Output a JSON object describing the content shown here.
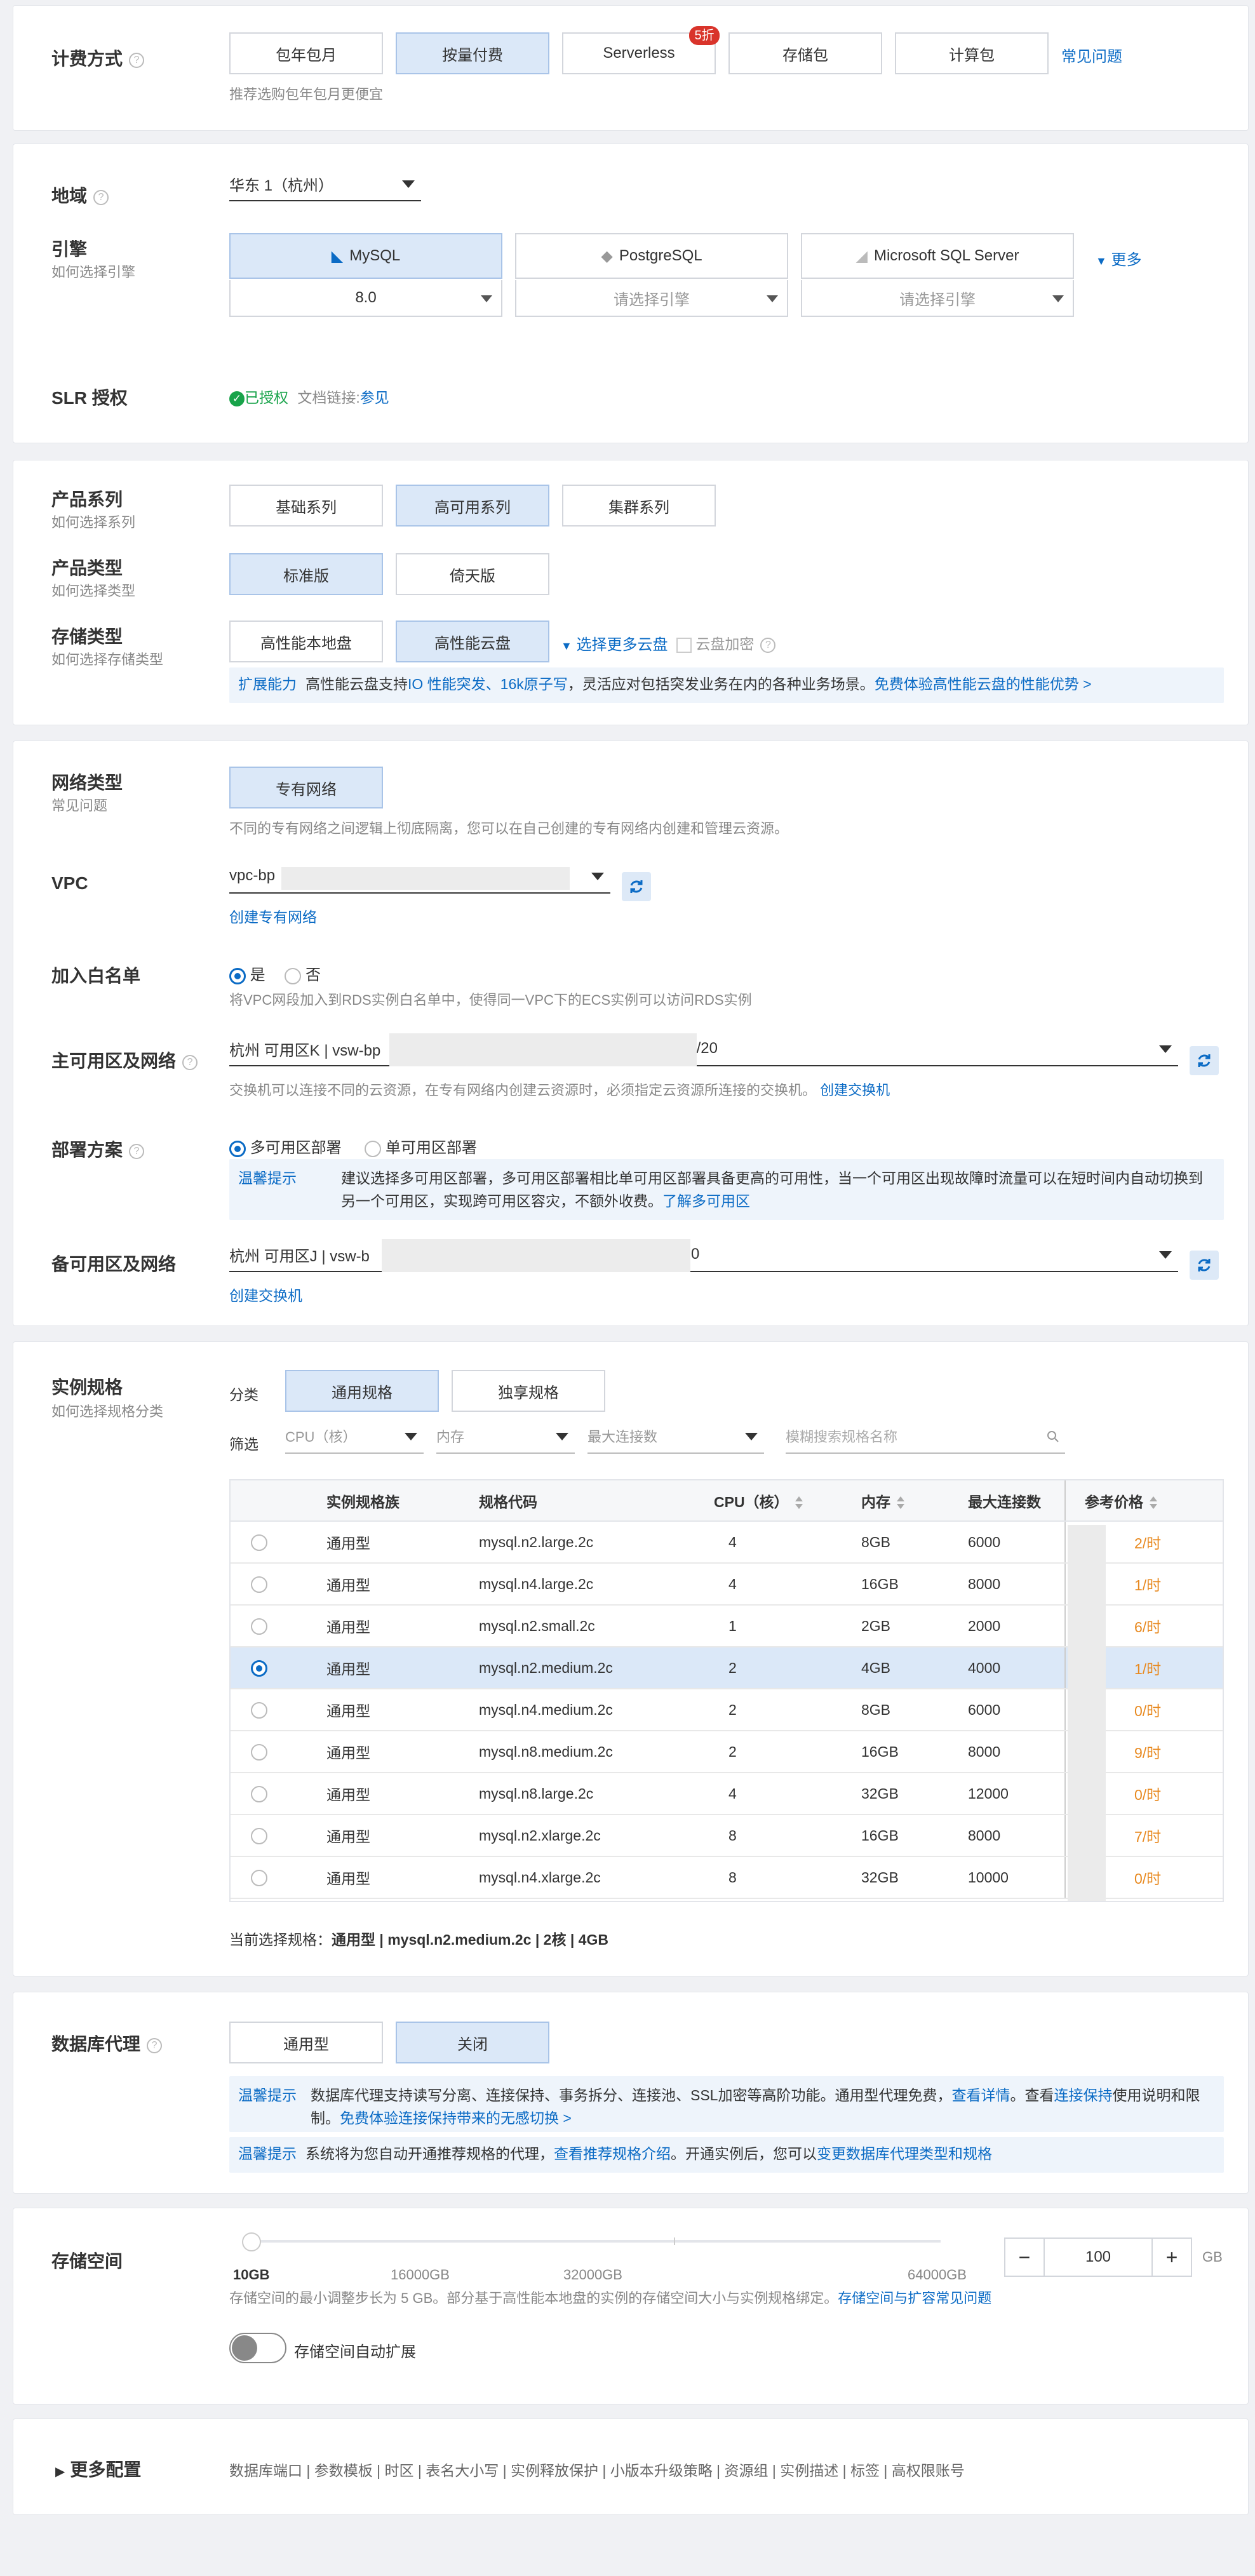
{
  "billing": {
    "label": "计费方式",
    "options": [
      "包年包月",
      "按量付费",
      "Serverless",
      "存储包",
      "计算包"
    ],
    "serverless_badge": "5折",
    "faq_link": "常见问题",
    "hint": "推荐选购包年包月更便宜"
  },
  "region": {
    "label": "地域",
    "value": "华东 1（杭州）"
  },
  "engine": {
    "label": "引擎",
    "sub": "如何选择引擎",
    "options": [
      {
        "name": "MySQL",
        "version": "8.0"
      },
      {
        "name": "PostgreSQL",
        "version": "请选择引擎"
      },
      {
        "name": "Microsoft SQL Server",
        "version": "请选择引擎"
      }
    ],
    "more": "更多"
  },
  "slr": {
    "label": "SLR 授权",
    "status": "已授权",
    "doc_prefix": "文档链接:",
    "doc_link": "参见"
  },
  "product_series": {
    "label": "产品系列",
    "sub": "如何选择系列",
    "options": [
      "基础系列",
      "高可用系列",
      "集群系列"
    ]
  },
  "product_type": {
    "label": "产品类型",
    "sub": "如何选择类型",
    "options": [
      "标准版",
      "倚天版"
    ]
  },
  "storage_type": {
    "label": "存储类型",
    "sub": "如何选择存储类型",
    "options": [
      "高性能本地盘",
      "高性能云盘"
    ],
    "more_disks": "选择更多云盘",
    "encrypt": "云盘加密",
    "ext_tag": "扩展能力",
    "ext_text1": "高性能云盘支持",
    "ext_link1": "IO 性能突发、16k原子写",
    "ext_text2": "，灵活应对包括突发业务在内的各种业务场景。",
    "ext_link2": "免费体验高性能云盘的性能优势 >"
  },
  "network": {
    "label": "网络类型",
    "sub": "常见问题",
    "option": "专有网络",
    "hint": "不同的专有网络之间逻辑上彻底隔离，您可以在自己创建的专有网络内创建和管理云资源。"
  },
  "vpc": {
    "label": "VPC",
    "value": "vpc-bp",
    "create_link": "创建专有网络"
  },
  "whitelist": {
    "label": "加入白名单",
    "yes": "是",
    "no": "否",
    "hint": "将VPC网段加入到RDS实例白名单中，使得同一VPC下的ECS实例可以访问RDS实例"
  },
  "primary_zone": {
    "label": "主可用区及网络",
    "value_prefix": "杭州 可用区K | vsw-bp",
    "value_suffix": "0/20",
    "hint": "交换机可以连接不同的云资源，在专有网络内创建云资源时，必须指定云资源所连接的交换机。",
    "hint_link": "创建交换机"
  },
  "deploy": {
    "label": "部署方案",
    "multi": "多可用区部署",
    "single": "单可用区部署",
    "tip_tag": "温馨提示",
    "tip_text": "建议选择多可用区部署，多可用区部署相比单可用区部署具备更高的可用性，当一个可用区出现故障时流量可以在短时间内自动切换到另一个可用区，实现跨可用区容灾，不额外收费。",
    "tip_link": "了解多可用区"
  },
  "secondary_zone": {
    "label": "备可用区及网络",
    "value_prefix": "杭州 可用区J | vsw-b",
    "value_suffix": "/20",
    "create_link": "创建交换机"
  },
  "spec": {
    "label": "实例规格",
    "sub": "如何选择规格分类",
    "category_label": "分类",
    "categories": [
      "通用规格",
      "独享规格"
    ],
    "filter_label": "筛选",
    "filters": [
      "CPU（核）",
      "内存",
      "最大连接数"
    ],
    "search_placeholder": "模糊搜索规格名称",
    "columns": [
      "实例规格族",
      "规格代码",
      "CPU（核）",
      "内存",
      "最大连接数",
      "参考价格"
    ],
    "rows": [
      {
        "family": "通用型",
        "code": "mysql.n2.large.2c",
        "cpu": "4",
        "mem": "8GB",
        "conn": "6000",
        "price": "2/时"
      },
      {
        "family": "通用型",
        "code": "mysql.n4.large.2c",
        "cpu": "4",
        "mem": "16GB",
        "conn": "8000",
        "price": "1/时"
      },
      {
        "family": "通用型",
        "code": "mysql.n2.small.2c",
        "cpu": "1",
        "mem": "2GB",
        "conn": "2000",
        "price": "6/时"
      },
      {
        "family": "通用型",
        "code": "mysql.n2.medium.2c",
        "cpu": "2",
        "mem": "4GB",
        "conn": "4000",
        "price": "1/时"
      },
      {
        "family": "通用型",
        "code": "mysql.n4.medium.2c",
        "cpu": "2",
        "mem": "8GB",
        "conn": "6000",
        "price": "0/时"
      },
      {
        "family": "通用型",
        "code": "mysql.n8.medium.2c",
        "cpu": "2",
        "mem": "16GB",
        "conn": "8000",
        "price": "9/时"
      },
      {
        "family": "通用型",
        "code": "mysql.n8.large.2c",
        "cpu": "4",
        "mem": "32GB",
        "conn": "12000",
        "price": "0/时"
      },
      {
        "family": "通用型",
        "code": "mysql.n2.xlarge.2c",
        "cpu": "8",
        "mem": "16GB",
        "conn": "8000",
        "price": "7/时"
      },
      {
        "family": "通用型",
        "code": "mysql.n4.xlarge.2c",
        "cpu": "8",
        "mem": "32GB",
        "conn": "10000",
        "price": "0/时"
      }
    ],
    "selected_index": 3,
    "current_prefix": "当前选择规格：",
    "current_value": "通用型 | mysql.n2.medium.2c | 2核 | 4GB"
  },
  "proxy": {
    "label": "数据库代理",
    "options": [
      "通用型",
      "关闭"
    ],
    "tip1_tag": "温馨提示",
    "tip1_text1": "数据库代理支持读写分离、连接保持、事务拆分、连接池、SSL加密等高阶功能。通用型代理免费，",
    "tip1_link1": "查看详情",
    "tip1_text2": "。查看",
    "tip1_link2": "连接保持",
    "tip1_text3": "使用说明和限制。",
    "tip1_link3": "免费体验连接保持带来的无感切换 >",
    "tip2_tag": "温馨提示",
    "tip2_text1": "系统将为您自动开通推荐规格的代理，",
    "tip2_link1": "查看推荐规格介绍",
    "tip2_text2": "。开通实例后，您可以",
    "tip2_link2": "变更数据库代理类型和规格"
  },
  "storage": {
    "label": "存储空间",
    "ticks": [
      "10GB",
      "16000GB",
      "32000GB",
      "64000GB"
    ],
    "value": "100",
    "unit": "GB",
    "minus": "−",
    "plus": "+",
    "hint": "存储空间的最小调整步长为 5 GB。部分基于高性能本地盘的实例的存储空间大小与实例规格绑定。",
    "hint_link": "存储空间与扩容常见问题",
    "auto_expand": "存储空间自动扩展"
  },
  "more_config": {
    "label": "更多配置",
    "items": "数据库端口 | 参数模板 | 时区 | 表名大小写 | 实例释放保护 | 小版本升级策略 | 资源组 | 实例描述 | 标签 | 高权限账号"
  }
}
